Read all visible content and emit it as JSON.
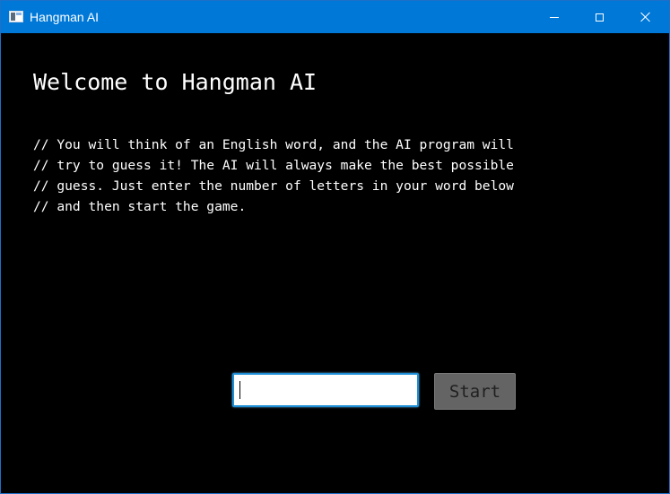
{
  "window": {
    "title": "Hangman AI",
    "app_icon": "window-app-icon",
    "controls": {
      "minimize_icon": "minimize-icon",
      "maximize_icon": "maximize-icon",
      "close_icon": "close-icon"
    },
    "titlebar_color": "#0078d7",
    "background_color": "#000000"
  },
  "main": {
    "heading": "Welcome to Hangman AI",
    "description_lines": [
      "// You will think of an English word, and the AI program will",
      "// try to guess it! The AI will always make the best possible",
      "// guess. Just enter the number of letters in your word below",
      "// and then start the game."
    ],
    "letters_input": {
      "value": "",
      "placeholder": ""
    },
    "start_button_label": "Start"
  }
}
